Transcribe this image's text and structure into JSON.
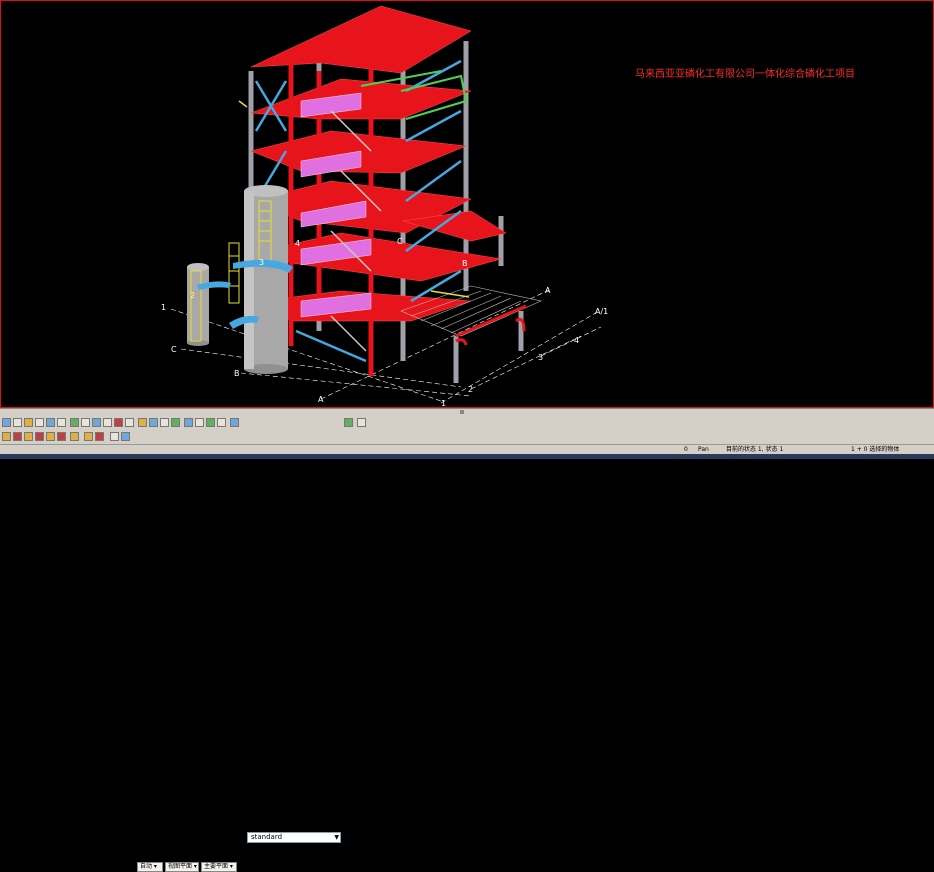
{
  "banner": {
    "text": "马来西亚亚磷化工有限公司一体化综合磷化工项目"
  },
  "grid_labels": {
    "left_1": "1",
    "left_c": "C",
    "left_b": "B",
    "bottom_a": "A",
    "bottom_1": "1",
    "bottom_2": "2",
    "bottom_3": "3",
    "right_4": "4",
    "right_a1": "A/1",
    "right_a": "A",
    "tower_2": "2",
    "tower_3": "3",
    "structure_4": "4",
    "structure_c": "C",
    "structure_b": "B"
  },
  "toolbar": {
    "view_select": "standard",
    "dd_auto": "自动",
    "dd_view_plane": "视图平面",
    "dd_main_plane": "主要平面"
  },
  "status": {
    "count": "0",
    "mode": "Pan",
    "state": "目前的状态 1, 状态 1",
    "selection": "1 + 0 选择的物体"
  },
  "colors": {
    "beam_red": "#e8141c",
    "column_gray": "#a0a0a8",
    "brace_blue": "#46a8e0",
    "stair_pink": "#e070e0",
    "ladder_yellow": "#e8e030",
    "grating_green": "#50d050"
  }
}
